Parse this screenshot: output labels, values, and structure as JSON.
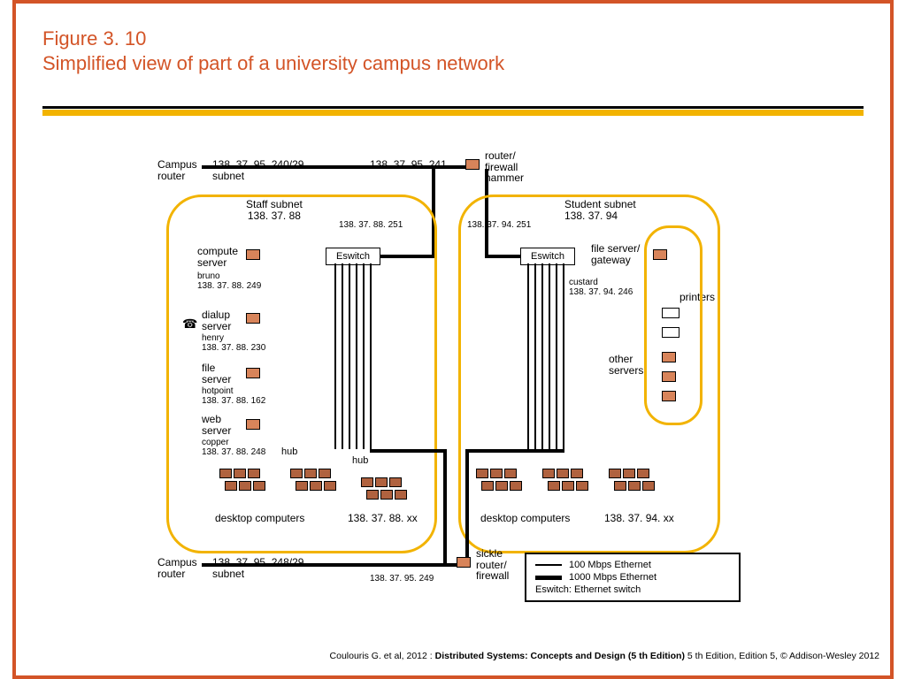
{
  "figure_no": "Figure 3. 10",
  "figure_title": "Simplified view of part of a university campus network",
  "top_campus_router": "Campus\nrouter",
  "top_router_subnet": "138. 37. 95. 240/29\nsubnet",
  "hammer_ip": "138. 37. 95. 241",
  "hammer_label": "router/\nfirewall\nhammer",
  "staff_subnet_title": "Staff subnet\n138. 37. 88",
  "staff_switch_ip": "138. 37. 88. 251",
  "eswitch_label": "Eswitch",
  "compute_server": "compute\nserver",
  "bruno": "bruno\n138. 37. 88. 249",
  "dialup_server": "dialup\nserver",
  "henry": "henry\n138. 37. 88. 230",
  "file_server_staff": "file\nserver",
  "hotpoint": "hotpoint\n138. 37. 88. 162",
  "web_server": "web\nserver",
  "copper": "copper\n138. 37. 88. 248",
  "hub_label": "hub",
  "desktop_computers": "desktop computers",
  "staff_xx": "138. 37. 88. xx",
  "student_subnet_title": "Student subnet\n138. 37. 94",
  "student_switch_ip": "138. 37. 94. 251",
  "file_gateway": "file server/\ngateway",
  "custard": "custard\n138. 37. 94. 246",
  "printers": "printers",
  "other_servers": "other\nservers",
  "student_xx": "138. 37. 94. xx",
  "bottom_campus_router": "Campus\nrouter",
  "bottom_router_subnet": "138. 37. 95. 248/29\nsubnet",
  "sickle_label": "sickle\nrouter/\nfirewall",
  "sickle_ip": "138. 37. 95. 249",
  "legend_100": "100 Mbps Ethernet",
  "legend_1000": "1000 Mbps Ethernet",
  "legend_es": "Eswitch:  Ethernet switch",
  "footer_a": "Coulouris G. et al, 2012 : ",
  "footer_b": "Distributed Systems: Concepts and Design (5 th Edition)",
  "footer_c": " 5 th Edition, Edition 5, © Addison-Wesley 2012"
}
